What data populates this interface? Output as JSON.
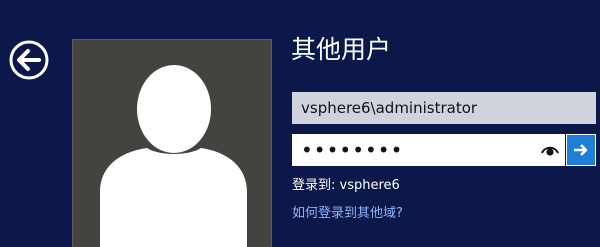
{
  "colors": {
    "background": "#0b1849",
    "avatar_tile": "#434340",
    "username_field": "#d1d3dc",
    "password_field": "#ffffff",
    "submit_button": "#1f7fd6",
    "link": "#8fb4ff"
  },
  "icons": {
    "back": "back-arrow-icon",
    "avatar": "user-silhouette-icon",
    "reveal": "eye-icon",
    "submit": "arrow-right-icon"
  },
  "login": {
    "title": "其他用户",
    "username_value": "vsphere6\\administrator",
    "password_masked": "••••••••",
    "sign_in_to_label": "登录到:",
    "sign_in_to_domain": "vsphere6",
    "other_domain_link": "如何登录到其他域?"
  }
}
